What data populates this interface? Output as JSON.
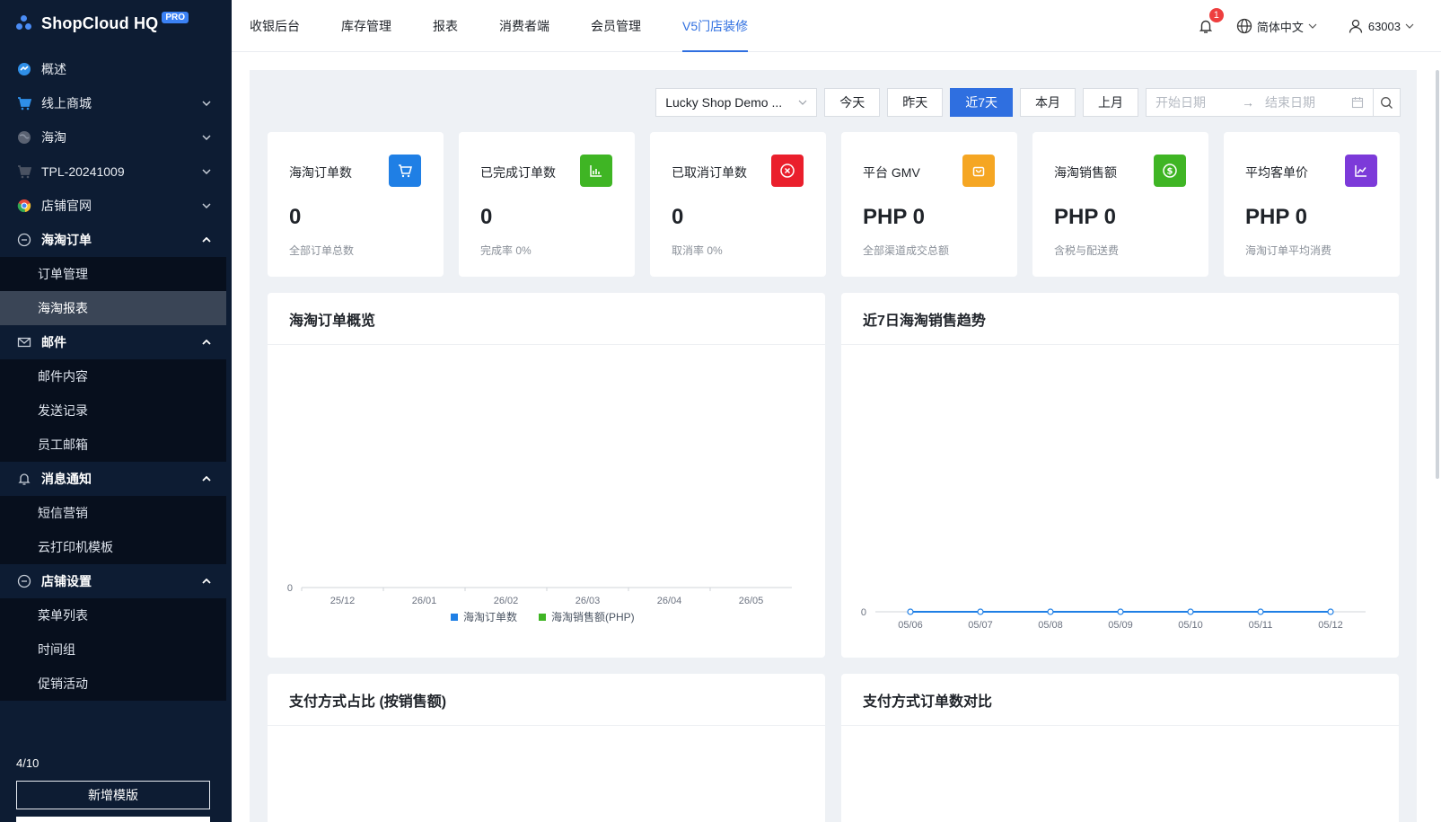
{
  "app": {
    "name": "ShopCloud HQ",
    "badge": "PRO"
  },
  "sidebar": {
    "items": [
      {
        "label": "概述",
        "icon": "dashboard-icon"
      },
      {
        "label": "线上商城",
        "icon": "cart-icon"
      },
      {
        "label": "海淘",
        "icon": "globe-icon"
      },
      {
        "label": "TPL-20241009",
        "icon": "cart-icon"
      },
      {
        "label": "店铺官网",
        "icon": "chrome-icon"
      },
      {
        "label": "海淘订单",
        "icon": "minus-circle-icon",
        "children": [
          "订单管理",
          "海淘报表"
        ]
      },
      {
        "label": "邮件",
        "icon": "mail-icon",
        "children": [
          "邮件内容",
          "发送记录",
          "员工邮箱"
        ]
      },
      {
        "label": "消息通知",
        "icon": "bell-icon",
        "children": [
          "短信营销",
          "云打印机模板"
        ]
      },
      {
        "label": "店铺设置",
        "icon": "minus-circle-icon",
        "children": [
          "菜单列表",
          "时间组",
          "促销活动"
        ]
      }
    ],
    "active_sub": "海淘报表",
    "template_count": "4/10",
    "add_template_label": "新增模版"
  },
  "topnav": {
    "tabs": [
      "收银后台",
      "库存管理",
      "报表",
      "消费者端",
      "会员管理",
      "V5门店装修"
    ],
    "active": "V5门店装修",
    "notification_count": "1",
    "language": "简体中文",
    "user": "63003"
  },
  "filters": {
    "shop": "Lucky Shop Demo ...",
    "ranges": [
      "今天",
      "昨天",
      "近7天",
      "本月",
      "上月"
    ],
    "active_range": "近7天",
    "start_placeholder": "开始日期",
    "end_placeholder": "结束日期",
    "arrow": "→"
  },
  "cards": [
    {
      "title": "海淘订单数",
      "value": "0",
      "sub": "全部订单总数",
      "icon": "cart-icon",
      "color": "#1f7fe5"
    },
    {
      "title": "已完成订单数",
      "value": "0",
      "sub": "完成率 0%",
      "icon": "bar-chart-icon",
      "color": "#3fb524"
    },
    {
      "title": "已取消订单数",
      "value": "0",
      "sub": "取消率 0%",
      "icon": "close-circle-icon",
      "color": "#ea1f2c"
    },
    {
      "title": "平台 GMV",
      "value": "PHP 0",
      "sub": "全部渠道成交总额",
      "icon": "bag-icon",
      "color": "#f5a623"
    },
    {
      "title": "海淘销售额",
      "value": "PHP 0",
      "sub": "含税与配送费",
      "icon": "dollar-icon",
      "color": "#3fb524"
    },
    {
      "title": "平均客单价",
      "value": "PHP 0",
      "sub": "海淘订单平均消费",
      "icon": "line-chart-icon",
      "color": "#7c3ad9"
    }
  ],
  "panels": {
    "overview_title": "海淘订单概览",
    "trend_title": "近7日海淘销售趋势",
    "payment_share_title": "支付方式占比 (按销售额)",
    "payment_orders_title": "支付方式订单数对比"
  },
  "chart_data": [
    {
      "type": "bar",
      "categories": [
        "25/12",
        "26/01",
        "26/02",
        "26/03",
        "26/04",
        "26/05"
      ],
      "series": [
        {
          "name": "海淘订单数",
          "values": [
            0,
            0,
            0,
            0,
            0,
            0
          ],
          "color": "#1f7fe5"
        },
        {
          "name": "海淘销售额(PHP)",
          "values": [
            0,
            0,
            0,
            0,
            0,
            0
          ],
          "color": "#3fb524"
        }
      ],
      "yticks": [
        "0"
      ],
      "legend": "bottom"
    },
    {
      "type": "line",
      "categories": [
        "05/06",
        "05/07",
        "05/08",
        "05/09",
        "05/10",
        "05/11",
        "05/12"
      ],
      "series": [
        {
          "values": [
            0,
            0,
            0,
            0,
            0,
            0,
            0
          ],
          "color": "#1f7fe5"
        }
      ],
      "yticks": [
        "0"
      ]
    }
  ]
}
